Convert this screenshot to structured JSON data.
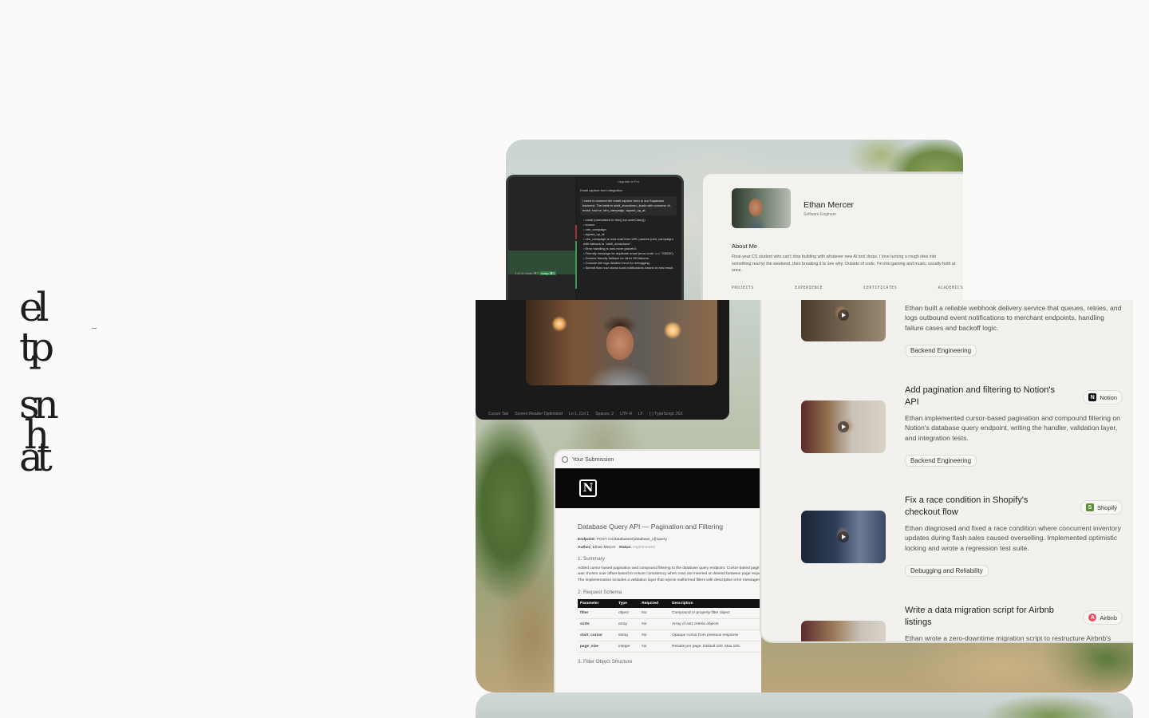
{
  "hero": {
    "glyphs": [
      "el",
      "tp",
      "sn",
      "h",
      "at"
    ]
  },
  "editor": {
    "upgrade_label": "Upgrade to Pro",
    "chat_title": "Email capture form integration",
    "request": "I need to connect the email capture form to our Supabase backend. The table is shell_showdown_leads with columns: id, email, source, utm_campaign, signed_up_at.",
    "bullets": [
      "email (normalized to trim().toLowerCase())",
      "source",
      "utm_campaign",
      "signed_up_at",
      "utm_campaign is now read from URL params (utm_campaign) with fallback to \"shell_showdown\".",
      "Error handling is now more graceful:",
      "Friendly message for duplicate email (error.code === \"23505\").",
      "Generic friendly fallback for other DB failures.",
      "Console still logs detailed error for debugging.",
      "Submit flow now shows toast notifications based on real result."
    ],
    "status_left": "1 of 11   Undo ⌘Z",
    "status_btn": "Keep ⌘Y"
  },
  "profile": {
    "name": "Ethan Mercer",
    "role": "Software Engineer",
    "about_heading": "About Me",
    "about_text": "Final-year CS student who can't stop building with whatever new AI tool drops. I love turning a rough idea into something real by the weekend, then breaking it to see why. Outside of code, I'm into gaming and music, usually both at once.",
    "tabs": [
      "PROJECTS",
      "EXPERIENCE",
      "CERTIFICATES",
      "ACADEMICS"
    ]
  },
  "video_window": {
    "statusbar": [
      "Cursor Tab",
      "Screen Reader Optimized",
      "Ln 1, Col 1",
      "Spaces: 2",
      "UTF-8",
      "LF",
      "{ } TypeScript JSX"
    ]
  },
  "submission": {
    "header": "Your Submission",
    "title": "Database Query API — Pagination and Filtering",
    "endpoint_label": "Endpoint:",
    "endpoint_value": "POST /v1/databases/{database_id}/query",
    "author_label": "Author:",
    "author_value": "Ethan Mercer",
    "status_label": "Status:",
    "status_value": "Implemented",
    "sec1": "1. Summary",
    "summary": "Added cursor-based pagination and compound filtering to the database query endpoint. Cursor-based pagination was chosen over offset-based to ensure consistency when rows are inserted or deleted between page requests. The implementation includes a validation layer that rejects malformed filters with descriptive error messages.",
    "sec2": "2. Request Schema",
    "table_headers": [
      "Parameter",
      "Type",
      "Required",
      "Description"
    ],
    "table_rows": [
      [
        "filter",
        "object",
        "No",
        "Compound or property filter object"
      ],
      [
        "sorts",
        "array",
        "No",
        "Array of sort criteria objects"
      ],
      [
        "start_cursor",
        "string",
        "No",
        "Opaque cursor from previous response"
      ],
      [
        "page_size",
        "integer",
        "No",
        "Results per page. Default 100. Max 100."
      ]
    ],
    "sec3": "3. Filter Object Structure"
  },
  "projects": [
    {
      "title": "",
      "desc": "Ethan built a reliable webhook delivery service that queues, retries, and logs outbound event notifications to merchant endpoints, handling failure cases and backoff logic.",
      "tag": "Backend Engineering",
      "company": ""
    },
    {
      "title": "Add pagination and filtering to Notion's API",
      "desc": "Ethan implemented cursor-based pagination and compound filtering on Notion's database query endpoint, writing the handler, validation layer, and integration tests.",
      "tag": "Backend Engineering",
      "company": "Notion"
    },
    {
      "title": "Fix a race condition in Shopify's checkout flow",
      "desc": "Ethan diagnosed and fixed a race condition where concurrent inventory updates during flash sales caused overselling. Implemented optimistic locking and wrote a regression test suite.",
      "tag": "Debugging and Reliability",
      "company": "Shopify"
    },
    {
      "title": "Write a data migration script for Airbnb listings",
      "desc": "Ethan wrote a zero-downtime migration script to restructure Airbnb's",
      "tag": "",
      "company": "Airbnb"
    }
  ]
}
